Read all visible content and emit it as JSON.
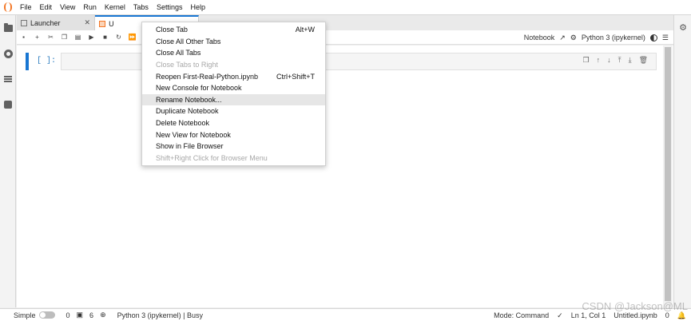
{
  "menubar": {
    "items": [
      "File",
      "Edit",
      "View",
      "Run",
      "Kernel",
      "Tabs",
      "Settings",
      "Help"
    ]
  },
  "tabs": [
    {
      "label": "Launcher"
    },
    {
      "label": "U"
    }
  ],
  "toolbar": {
    "notebook_label": "Notebook",
    "kernel_label": "Python 3 (ipykernel)"
  },
  "cell": {
    "prompt": "[ ]:"
  },
  "context_menu": {
    "items": [
      {
        "label": "Close Tab",
        "shortcut": "Alt+W",
        "disabled": false
      },
      {
        "label": "Close All Other Tabs",
        "shortcut": "",
        "disabled": false
      },
      {
        "label": "Close All Tabs",
        "shortcut": "",
        "disabled": false
      },
      {
        "label": "Close Tabs to Right",
        "shortcut": "",
        "disabled": true
      },
      {
        "label": "Reopen First-Real-Python.ipynb",
        "shortcut": "Ctrl+Shift+T",
        "disabled": false
      },
      {
        "label": "New Console for Notebook",
        "shortcut": "",
        "disabled": false
      },
      {
        "label": "Rename Notebook...",
        "shortcut": "",
        "disabled": false,
        "hovered": true
      },
      {
        "label": "Duplicate Notebook",
        "shortcut": "",
        "disabled": false
      },
      {
        "label": "Delete Notebook",
        "shortcut": "",
        "disabled": false
      },
      {
        "label": "New View for Notebook",
        "shortcut": "",
        "disabled": false
      },
      {
        "label": "Show in File Browser",
        "shortcut": "",
        "disabled": false
      },
      {
        "label": "Shift+Right Click for Browser Menu",
        "shortcut": "",
        "disabled": true
      }
    ]
  },
  "statusbar": {
    "simple_label": "Simple",
    "count_a": "0",
    "count_b": "6",
    "kernel_status": "Python 3 (ipykernel) | Busy",
    "mode": "Mode: Command",
    "position": "Ln 1, Col 1",
    "filename": "Untitled.ipynb",
    "notif_count": "0"
  },
  "watermark": "CSDN @Jackson@ML"
}
